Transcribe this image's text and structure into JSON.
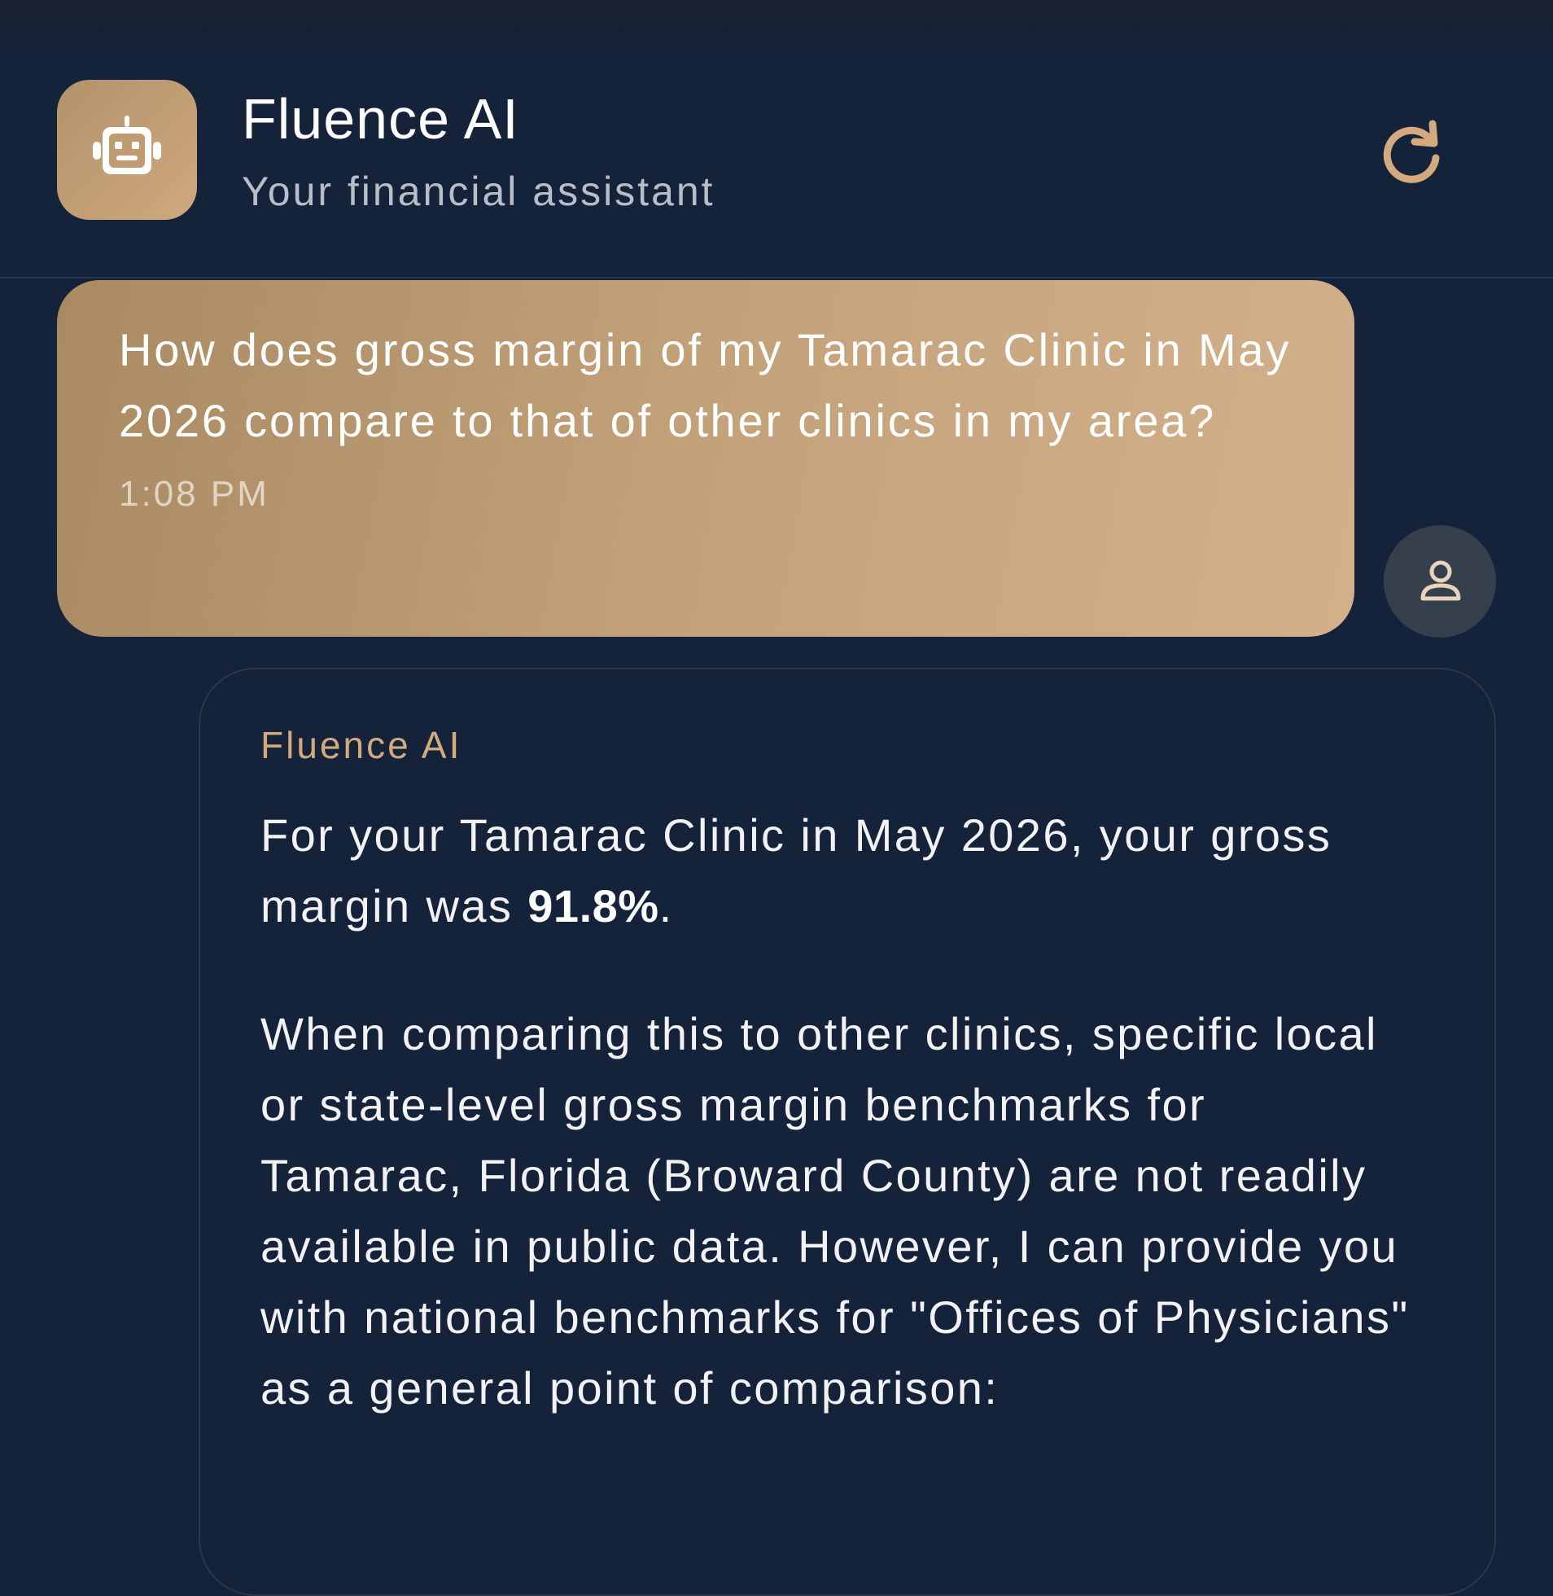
{
  "header": {
    "title": "Fluence AI",
    "subtitle": "Your financial assistant",
    "logo_icon": "robot-icon",
    "refresh_icon": "refresh-icon"
  },
  "colors": {
    "background": "#15233a",
    "accent": "#cfa87e",
    "user_bubble_start": "#a98a62",
    "user_bubble_end": "#d3b08b",
    "ai_label": "#d2aa7e"
  },
  "messages": {
    "user": {
      "text": "How does gross margin of my Tamarac Clinic in May 2026 compare to that of other clinics in my area?",
      "time": "1:08 PM",
      "avatar_icon": "user-icon"
    },
    "assistant": {
      "sender": "Fluence AI",
      "para1_prefix": "For your Tamarac Clinic in May 2026, your gross margin was ",
      "para1_value": "91.8%",
      "para1_suffix": ".",
      "para2": "When comparing this to other clinics, specific local or state-level gross margin benchmarks for Tamarac, Florida (Broward County) are not readily available in public data. However, I can provide you with national benchmarks for \"Offices of Physicians\" as a general point of comparison:"
    }
  }
}
